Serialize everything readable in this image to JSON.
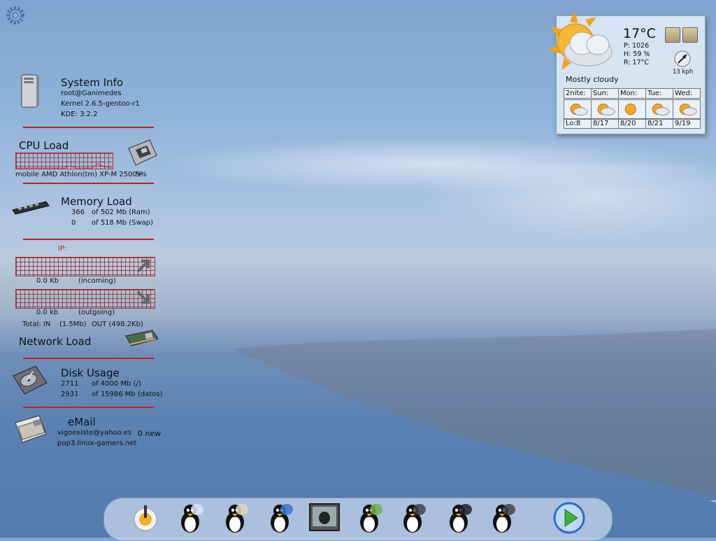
{
  "desktop": {
    "kde_menu_icon": "kde-gear-icon"
  },
  "system_info": {
    "title": "System Info",
    "user": "root@Ganimedes",
    "kernel": "Kernel  2.6.5-gentoo-r1",
    "kde": "KDE: 3.2.2",
    "icon": "computer-tower-icon"
  },
  "cpu": {
    "title": "CPU Load",
    "processor": "mobile AMD Athlon(tm) XP-M 2500+",
    "load": "5%",
    "icon": "cpu-chip-icon"
  },
  "memory": {
    "title": "Memory Load",
    "ram_used": "366",
    "ram_total": "of 502 Mb (Ram)",
    "swap_used": "0",
    "swap_total": "of 518 Mb (Swap)",
    "icon": "ram-stick-icon"
  },
  "network": {
    "ip_label": "IP:",
    "in_rate": "0.0 Kb",
    "in_label": "(incoming)",
    "out_rate": "0.0 kb",
    "out_label": "(outgoing)",
    "total_in_label": "Total:  IN",
    "total_in": "(1.5Mb)",
    "total_out": "OUT (498.2Kb)",
    "title": "Network Load",
    "icon": "network-card-icon"
  },
  "disk": {
    "title": "Disk Usage",
    "root_used": "2711",
    "root_total": "of 4000 Mb (/)",
    "datos_used": "2931",
    "datos_total": "of 15986 Mb (datos)",
    "icon": "hard-disk-icon"
  },
  "email": {
    "title": "eMail",
    "account": "vigoexiste@yahoo.es",
    "server": "pop3.linux-gamers.net",
    "new_count": "0 new",
    "icon": "mail-icon"
  },
  "weather": {
    "temperature": "17°C",
    "pressure": "P:  1026",
    "humidity": "H:  59 %",
    "realfeel": "R:  17°C",
    "wind": "13 kph",
    "condition": "Mostly cloudy",
    "forecast": [
      {
        "day": "2nite:",
        "low": "Lo:8",
        "icon": "sun-cloud-icon"
      },
      {
        "day": "Sun:",
        "low": "8/17",
        "icon": "sun-cloud-icon"
      },
      {
        "day": "Mon:",
        "low": "8/20",
        "icon": "sun-icon"
      },
      {
        "day": "Tue:",
        "low": "8/21",
        "icon": "sun-cloud-icon"
      },
      {
        "day": "Wed:",
        "low": "9/19",
        "icon": "sun-cloud-icon"
      }
    ]
  },
  "dock": {
    "items": [
      "kde-start-icon",
      "igloo-penguin-icon",
      "stamp-penguin-icon",
      "penguin-browser-icon",
      "terminal-penguin-icon",
      "penguin-messenger-icon",
      "penguin-media-icon",
      "penguin-settings-icon",
      "penguin-search-icon",
      "play-button-icon"
    ]
  },
  "colors": {
    "accent_red": "#b22222",
    "panel_bg": "#dce8f4"
  }
}
